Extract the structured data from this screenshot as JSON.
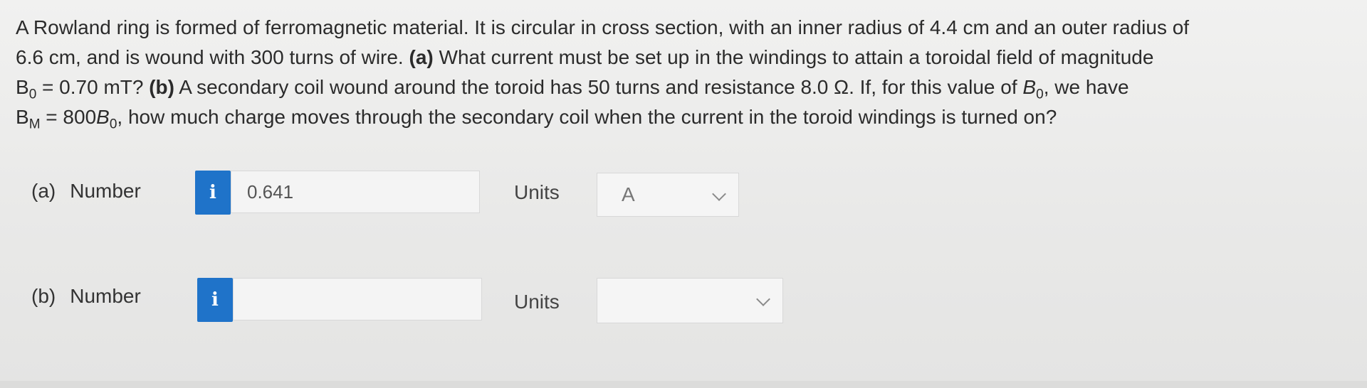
{
  "question": {
    "line1": "A Rowland ring is formed of ferromagnetic material. It is circular in cross section, with an inner radius of 4.4 cm and an outer radius of",
    "line2_a": "6.6 cm, and is wound with 300 turns of wire. ",
    "line2_part": "(a)",
    "line2_b": " What current must be set up in the windings to attain a toroidal field of magnitude",
    "line3_B": "B",
    "line3_sub": "0",
    "line3_a": " = 0.70 mT? ",
    "line3_part": "(b)",
    "line3_b": " A secondary coil wound around the toroid has 50 turns and resistance 8.0 Ω. If, for this value of ",
    "line3_B2": "B",
    "line3_sub2": "0",
    "line3_c": ", we have",
    "line4_B": "B",
    "line4_sub": "M",
    "line4_a": " = 800",
    "line4_B2": "B",
    "line4_sub2": "0",
    "line4_b": ", how much charge moves through the secondary coil when the current in the toroid windings is turned on?"
  },
  "part_a": {
    "letter": "(a)",
    "label": "Number",
    "info_icon": "i",
    "value": "0.641",
    "units_label": "Units",
    "units_value": "A"
  },
  "part_b": {
    "letter": "(b)",
    "label": "Number",
    "info_icon": "i",
    "value": "",
    "units_label": "Units",
    "units_value": ""
  },
  "colors": {
    "info_button": "#1f73c9",
    "background": "#ececeb"
  }
}
